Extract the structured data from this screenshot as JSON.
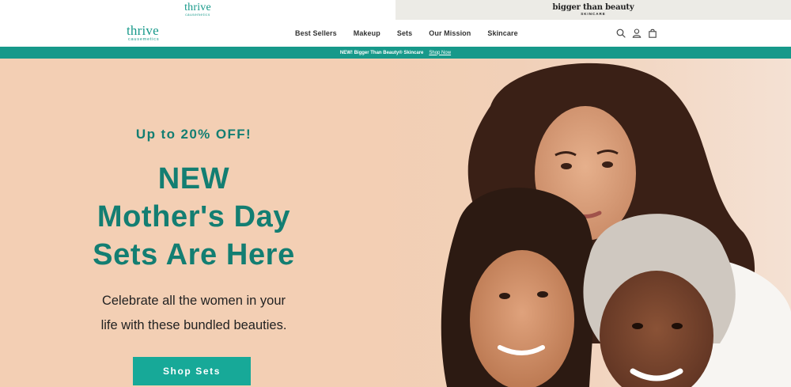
{
  "brand_switcher": {
    "thrive": {
      "logo_main": "thrive",
      "logo_sub": "causemetics"
    },
    "btb": {
      "logo_main": "bigger than beauty",
      "logo_sub": "SKINCARE"
    }
  },
  "header": {
    "logo_main": "thrive",
    "logo_sub": "causemetics",
    "nav": [
      "Best Sellers",
      "Makeup",
      "Sets",
      "Our Mission",
      "Skincare"
    ],
    "icons": [
      "search-icon",
      "account-icon",
      "bag-icon"
    ]
  },
  "promo": {
    "text": "NEW! Bigger Than Beauty® Skincare",
    "link": "Shop Now"
  },
  "hero": {
    "kicker": "Up to 20% OFF!",
    "headline_lines": [
      "NEW",
      "Mother's Day",
      "Sets Are Here"
    ],
    "subcopy_lines": [
      "Celebrate all the women in your",
      "life with these bundled beauties."
    ],
    "cta": "Shop Sets"
  },
  "colors": {
    "teal": "#17998a",
    "teal_dark": "#137e72",
    "hero_bg": "#f3cfb4",
    "btb_bg": "#ecebe6"
  }
}
